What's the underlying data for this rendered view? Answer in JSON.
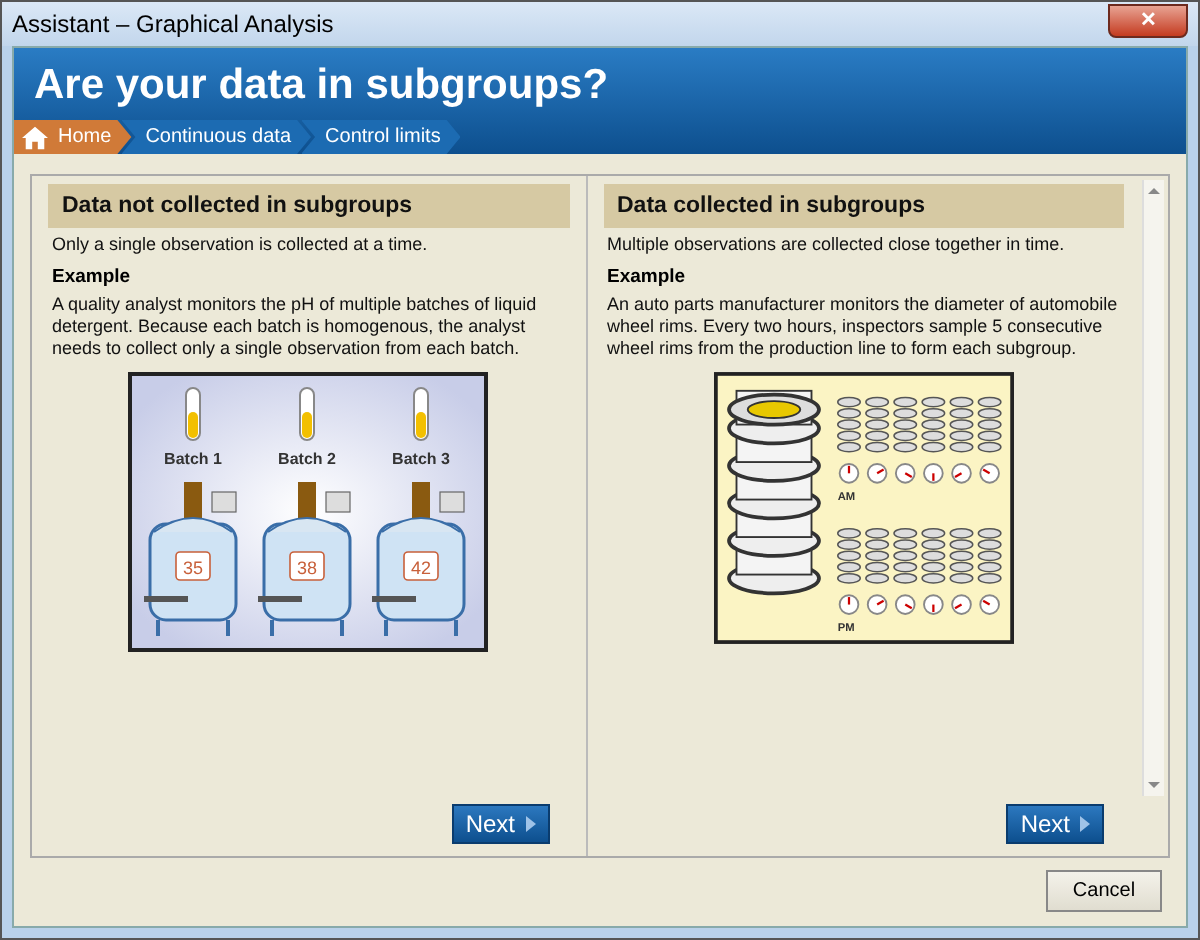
{
  "window": {
    "title": "Assistant – Graphical Analysis",
    "close": "✕"
  },
  "header": {
    "title": "Are your data in subgroups?"
  },
  "breadcrumb": [
    {
      "label": "Home",
      "kind": "home",
      "selected": true
    },
    {
      "label": "Continuous data",
      "kind": "step",
      "selected": false
    },
    {
      "label": "Control limits",
      "kind": "step",
      "selected": false
    }
  ],
  "panels": [
    {
      "kind": "batches",
      "title": "Data not collected in subgroups",
      "description": "Only a single observation is collected at a time.",
      "example_heading": "Example",
      "example_text": "A quality analyst monitors the pH of multiple batches of liquid detergent. Because each batch is homogenous, the analyst needs to collect only a single observation from each batch.",
      "batches": [
        {
          "label": "Batch 1",
          "reading": "35"
        },
        {
          "label": "Batch 2",
          "reading": "38"
        },
        {
          "label": "Batch 3",
          "reading": "42"
        }
      ],
      "next_button": "Next"
    },
    {
      "kind": "wheels",
      "title": "Data collected in subgroups",
      "description": "Multiple observations are collected close together in time.",
      "example_heading": "Example",
      "example_text": "An auto parts manufacturer monitors the diameter of automobile wheel rims. Every two hours, inspectors sample 5 consecutive wheel rims from the production line to form each subgroup.",
      "rows": [
        {
          "label": "AM"
        },
        {
          "label": "PM"
        }
      ],
      "next_button": "Next"
    }
  ],
  "cancel_button": "Cancel"
}
